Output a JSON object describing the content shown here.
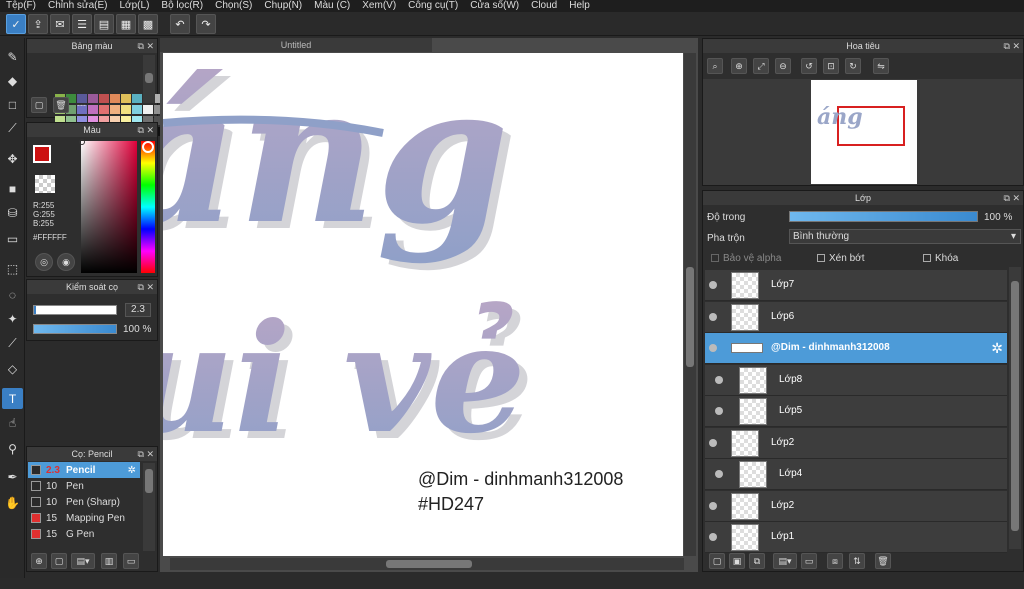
{
  "menu": [
    "Tệp(F)",
    "Chỉnh sửa(E)",
    "Lớp(L)",
    "Bộ lọc(R)",
    "Chọn(S)",
    "Chụp(N)",
    "Màu (C)",
    "Xem(V)",
    "Công cụ(T)",
    "Cửa sổ(W)",
    "Cloud",
    "Help"
  ],
  "document": {
    "tab_title": "Untitled"
  },
  "panels": {
    "swatches_title": "Bảng màu",
    "swatches_label": "---",
    "color_title": "Màu",
    "color": {
      "r": "R:255",
      "g": "G:255",
      "b": "B:255",
      "hex": "#FFFFFF",
      "primary": "#cc1111",
      "secondary": "#ffffff"
    },
    "brush_control_title": "Kiểm soát cọ",
    "brush_size": "2.3",
    "brush_opacity": "100 %",
    "brush_list_title": "Cọ: Pencil",
    "brushes": [
      {
        "size": "2.3",
        "name": "Pencil",
        "color": "#2a2a2a",
        "active": true
      },
      {
        "size": "10",
        "name": "Pen",
        "color": "#2a2a2a"
      },
      {
        "size": "10",
        "name": "Pen (Sharp)",
        "color": "#2a2a2a"
      },
      {
        "size": "15",
        "name": "Mapping Pen",
        "color": "#e03030"
      },
      {
        "size": "15",
        "name": "G Pen",
        "color": "#e03030"
      }
    ],
    "navigator_title": "Hoa tiêu",
    "layers_title": "Lớp",
    "opacity_label": "Độ trong",
    "opacity_value": "100 %",
    "blend_label": "Pha trộn",
    "blend_value": "Bình thường",
    "protect_alpha": "Bảo vệ alpha",
    "clipping": "Xén bớt",
    "lock": "Khóa"
  },
  "layers": [
    {
      "name": "Lớp7",
      "indent": false
    },
    {
      "name": "Lớp6",
      "indent": false
    },
    {
      "name": "@Dim - dinhmanh312008",
      "indent": false,
      "selected": true,
      "folder": true
    },
    {
      "name": "Lớp8",
      "indent": true
    },
    {
      "name": "Lớp5",
      "indent": true
    },
    {
      "name": "Lớp2",
      "indent": false
    },
    {
      "name": "Lớp4",
      "indent": true
    },
    {
      "name": "Lớp2",
      "indent": false
    },
    {
      "name": "Lớp1",
      "indent": false
    }
  ],
  "canvas_text": {
    "watermark_line1": "@Dim - dinhmanh312008",
    "watermark_line2": "#HD247",
    "art_line1": "áng",
    "art_line2": "ui vẻ"
  },
  "colors": {
    "accent": "#4d9bd8",
    "letter": "#9aa6c8"
  }
}
